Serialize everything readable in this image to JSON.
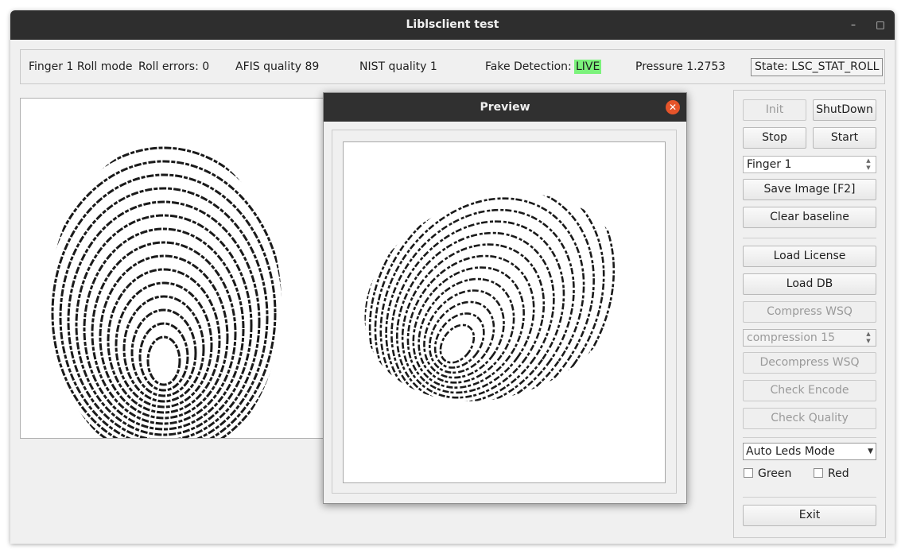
{
  "window": {
    "title": "Liblsclient test",
    "minimize_glyph": "–",
    "maximize_glyph": "□"
  },
  "status": {
    "finger_mode": "Finger 1 Roll mode",
    "roll_errors": "Roll errors: 0",
    "afis_quality": "AFIS quality 89",
    "nist_quality": "NIST quality 1",
    "fake_detection_label": "Fake Detection:",
    "fake_detection_value": "LIVE",
    "pressure": "Pressure 1.2753",
    "state": "State: LSC_STAT_ROLL"
  },
  "panel": {
    "init": "Init",
    "shutdown": "ShutDown",
    "stop": "Stop",
    "start": "Start",
    "finger_select": "Finger 1",
    "save_image": "Save Image [F2]",
    "clear_baseline": "Clear baseline",
    "load_license": "Load License",
    "load_db": "Load DB",
    "compress_wsq": "Compress WSQ",
    "compression": "compression 15",
    "decompress_wsq": "Decompress WSQ",
    "check_encode": "Check Encode",
    "check_quality": "Check Quality",
    "led_mode": "Auto Leds Mode",
    "green_label": "Green",
    "red_label": "Red",
    "exit": "Exit"
  },
  "preview": {
    "title": "Preview",
    "close_glyph": "✕"
  },
  "colors": {
    "titlebar": "#2e2e2e",
    "live_badge": "#7cf27c",
    "close_button": "#e5542a"
  }
}
